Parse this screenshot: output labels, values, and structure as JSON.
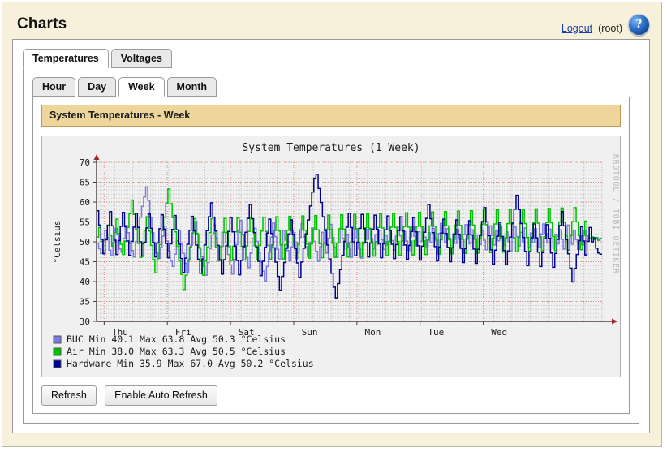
{
  "header": {
    "title": "Charts",
    "logout_label": "Logout",
    "user_label": "(root)",
    "help_glyph": "?"
  },
  "tabs_primary": [
    {
      "label": "Temperatures",
      "active": true
    },
    {
      "label": "Voltages",
      "active": false
    }
  ],
  "tabs_secondary": [
    {
      "label": "Hour",
      "active": false
    },
    {
      "label": "Day",
      "active": false
    },
    {
      "label": "Week",
      "active": true
    },
    {
      "label": "Month",
      "active": false
    }
  ],
  "section": {
    "banner_title": "System Temperatures - Week"
  },
  "buttons": {
    "refresh": "Refresh",
    "auto_refresh": "Enable Auto Refresh"
  },
  "chart_data": {
    "type": "line",
    "title": "System Temperatures (1 Week)",
    "watermark": "RRDTOOL / TOBI OETIKER",
    "xlabel": "",
    "ylabel": "°Celsius",
    "ylim": [
      30,
      70
    ],
    "ytick_step": 5,
    "yticks": [
      30,
      35,
      40,
      45,
      50,
      55,
      60,
      65,
      70
    ],
    "xticks": [
      "Thu",
      "Fri",
      "Sat",
      "Sun",
      "Mon",
      "Tue",
      "Wed"
    ],
    "grid": true,
    "grid_major_color": "#e08a80",
    "grid_minor_color": "#c9c9c9",
    "plot_bg": "#f0f0f0",
    "axis_color": "#4a3a3a",
    "axis_arrow_color": "#9c2a2a",
    "legend_position": "below",
    "series": [
      {
        "name": "BUC",
        "color": "#7b7be0",
        "min_label": "Min",
        "min": "40.1",
        "max_label": "Max",
        "max": "63.8",
        "avg_label": "Avg",
        "avg": "50.3",
        "unit": "°Celsius",
        "values": [
          49.6,
          48.3,
          47.1,
          50.4,
          52.8,
          51.2,
          47.9,
          46.5,
          49.8,
          53.4,
          51.7,
          48.2,
          47.4,
          50.9,
          54.1,
          52.3,
          49.6,
          47.8,
          46.2,
          50.1,
          53.8,
          56.2,
          58.9,
          61.3,
          63.8,
          60.4,
          56.1,
          52.3,
          49.7,
          47.2,
          45.8,
          48.6,
          51.4,
          53.9,
          50.2,
          47.6,
          45.1,
          43.8,
          46.9,
          50.3,
          52.8,
          49.4,
          47.1,
          44.6,
          42.3,
          45.7,
          49.2,
          52.6,
          55.1,
          51.8,
          48.4,
          46.2,
          43.9,
          41.6,
          44.8,
          48.3,
          51.7,
          54.2,
          50.9,
          47.5,
          45.3,
          48.9,
          52.4,
          49.7,
          46.8,
          44.2,
          41.9,
          45.6,
          49.3,
          52.8,
          55.4,
          51.9,
          48.6,
          46.1,
          43.5,
          47.2,
          50.8,
          53.4,
          50.1,
          47.3,
          44.9,
          42.6,
          40.1,
          43.8,
          47.4,
          51.2,
          54.7,
          51.3,
          48.1,
          45.7,
          49.3,
          52.9,
          50.4,
          47.8,
          45.2,
          48.7,
          52.3,
          49.9,
          47.4,
          51.1,
          54.6,
          51.2,
          48.8,
          46.3,
          49.9,
          53.5,
          50.1,
          47.6,
          45.1,
          48.8,
          52.4,
          49.8,
          47.2,
          50.9,
          54.4,
          51.1,
          48.6,
          46.2,
          49.8,
          53.3,
          50.9,
          48.4,
          51.9,
          48.5,
          46.1,
          49.7,
          53.2,
          50.8,
          48.3,
          45.9,
          49.5,
          53.1,
          50.6,
          53.2,
          50.7,
          48.3,
          51.8,
          49.4,
          52.9,
          50.5,
          48.1,
          51.6,
          49.2,
          52.7,
          50.3,
          47.9,
          51.4,
          53.9,
          51.5,
          49.1,
          52.6,
          50.2,
          47.8,
          51.3,
          53.8,
          51.4,
          49.0,
          52.5,
          50.1,
          53.6,
          51.2,
          48.8,
          52.3,
          49.9,
          53.4,
          51.0,
          48.6,
          52.1,
          54.6,
          52.2,
          49.8,
          53.3,
          50.9,
          48.5,
          52.0,
          49.6,
          53.1,
          50.7,
          48.3,
          51.8,
          54.3,
          51.9,
          49.5,
          53.0,
          50.6,
          48.2,
          51.7,
          49.3,
          52.8,
          50.4,
          48.0,
          51.5,
          54.0,
          51.6,
          49.2,
          52.7,
          50.3,
          53.8,
          51.4,
          49.0,
          52.5,
          50.1,
          47.7,
          51.2,
          53.7,
          51.3,
          48.9,
          52.4,
          50.0,
          53.5,
          51.1,
          48.7,
          52.2,
          49.8,
          53.3,
          50.9,
          48.5,
          52.0,
          54.5,
          52.1,
          49.7,
          53.2,
          50.8,
          48.4,
          51.9,
          49.5,
          53.0,
          50.6,
          48.2,
          51.7,
          54.2,
          51.8,
          49.4,
          52.9,
          50.5,
          48.1,
          51.6,
          49.2,
          52.7,
          50.3,
          51.0,
          50.8,
          51.2,
          50.6,
          51.1,
          50.4,
          50.9
        ]
      },
      {
        "name": "Air",
        "color": "#00c000",
        "min_label": "Min",
        "min": "38.0",
        "max_label": "Max",
        "max": "63.3",
        "avg_label": "Avg",
        "avg": "50.5",
        "unit": "°Celsius",
        "values": [
          51.2,
          53.6,
          50.1,
          47.4,
          50.8,
          54.2,
          51.6,
          48.9,
          52.3,
          55.7,
          52.1,
          49.4,
          46.8,
          50.2,
          53.6,
          57.1,
          60.5,
          56.9,
          53.2,
          49.6,
          46.1,
          49.5,
          52.9,
          56.3,
          52.7,
          49.1,
          45.6,
          42.2,
          45.8,
          49.3,
          52.8,
          56.2,
          59.7,
          63.3,
          59.6,
          56.1,
          52.5,
          48.9,
          45.3,
          41.8,
          38.0,
          41.6,
          45.2,
          48.7,
          52.2,
          55.8,
          52.1,
          48.6,
          45.1,
          41.6,
          45.2,
          48.7,
          52.3,
          55.8,
          52.2,
          48.7,
          45.2,
          48.8,
          52.4,
          55.9,
          52.3,
          48.8,
          45.3,
          48.9,
          52.5,
          56.0,
          52.4,
          48.9,
          45.4,
          49.0,
          52.6,
          56.1,
          52.5,
          49.0,
          45.5,
          49.1,
          52.7,
          56.2,
          52.6,
          49.1,
          45.6,
          49.2,
          52.8,
          56.3,
          52.7,
          49.2,
          45.7,
          49.3,
          52.9,
          56.4,
          52.8,
          49.3,
          45.8,
          49.4,
          53.0,
          56.5,
          52.9,
          49.4,
          45.9,
          49.5,
          53.1,
          56.6,
          53.0,
          49.5,
          46.0,
          49.6,
          53.2,
          56.7,
          53.1,
          49.6,
          46.1,
          49.7,
          53.3,
          56.8,
          53.2,
          49.7,
          46.2,
          49.8,
          53.4,
          56.9,
          53.3,
          49.8,
          46.3,
          49.9,
          53.5,
          57.0,
          53.4,
          49.9,
          46.4,
          50.0,
          53.6,
          57.1,
          53.5,
          50.0,
          46.5,
          50.1,
          53.7,
          57.2,
          53.6,
          50.1,
          46.6,
          50.2,
          53.8,
          57.3,
          53.7,
          50.2,
          46.7,
          50.3,
          53.9,
          57.4,
          53.8,
          50.3,
          46.8,
          50.4,
          54.0,
          57.5,
          53.9,
          50.4,
          46.9,
          50.5,
          54.1,
          57.6,
          54.0,
          50.5,
          47.0,
          50.6,
          54.2,
          57.7,
          54.1,
          50.6,
          47.1,
          50.7,
          54.3,
          57.8,
          54.2,
          50.7,
          47.2,
          50.8,
          54.4,
          57.9,
          54.3,
          50.8,
          47.3,
          50.9,
          54.5,
          58.0,
          54.4,
          50.9,
          47.4,
          51.0,
          54.6,
          58.1,
          54.5,
          51.0,
          47.5,
          51.1,
          54.7,
          58.2,
          54.6,
          51.1,
          47.6,
          51.2,
          54.8,
          58.3,
          54.7,
          51.2,
          47.7,
          51.3,
          54.9,
          58.4,
          54.8,
          51.3,
          47.8,
          51.4,
          55.0,
          58.5,
          54.9,
          51.4,
          47.9,
          51.5,
          55.1,
          58.6,
          55.0,
          51.5,
          48.0,
          51.6,
          55.2,
          51.4,
          50.8,
          51.2,
          50.6,
          51.0,
          50.4,
          50.8
        ]
      },
      {
        "name": "Hardware",
        "color": "#000090",
        "min_label": "Min",
        "min": "35.9",
        "max_label": "Max",
        "max": "67.0",
        "avg_label": "Avg",
        "avg": "50.2",
        "unit": "°Celsius",
        "values": [
          57.8,
          54.2,
          50.6,
          47.0,
          50.5,
          54.1,
          57.6,
          54.0,
          50.4,
          46.8,
          50.3,
          53.9,
          57.4,
          53.8,
          50.2,
          46.6,
          50.1,
          53.7,
          57.2,
          53.6,
          50.0,
          46.4,
          49.9,
          53.5,
          57.0,
          53.4,
          49.8,
          46.2,
          49.7,
          53.3,
          56.8,
          53.2,
          49.6,
          46.0,
          49.5,
          53.1,
          56.6,
          53.0,
          49.4,
          45.8,
          42.3,
          45.9,
          49.4,
          52.9,
          56.4,
          52.8,
          49.2,
          45.6,
          42.1,
          45.7,
          49.2,
          52.8,
          56.3,
          59.8,
          56.2,
          52.7,
          49.1,
          45.5,
          41.9,
          45.5,
          49.0,
          52.6,
          56.1,
          52.5,
          48.9,
          45.3,
          41.7,
          45.3,
          48.8,
          52.4,
          55.9,
          59.4,
          55.8,
          52.3,
          48.7,
          45.1,
          41.5,
          45.1,
          48.6,
          52.2,
          55.7,
          52.1,
          48.5,
          44.9,
          41.3,
          37.8,
          41.3,
          44.8,
          48.4,
          52.0,
          55.5,
          51.9,
          48.3,
          44.7,
          41.1,
          44.9,
          48.4,
          52.0,
          55.5,
          59.0,
          62.5,
          66.0,
          67.0,
          63.4,
          59.9,
          56.3,
          52.8,
          49.2,
          45.7,
          42.1,
          38.6,
          35.9,
          39.5,
          43.0,
          46.6,
          50.1,
          53.7,
          57.2,
          53.6,
          50.0,
          46.5,
          49.9,
          53.4,
          56.9,
          53.3,
          49.8,
          46.2,
          49.7,
          53.2,
          56.7,
          53.1,
          49.6,
          46.0,
          49.5,
          53.0,
          56.5,
          52.9,
          49.4,
          45.8,
          49.3,
          52.8,
          56.3,
          52.7,
          49.2,
          45.6,
          49.1,
          52.6,
          56.1,
          52.5,
          49.0,
          45.4,
          48.9,
          52.4,
          55.9,
          59.4,
          55.8,
          52.3,
          48.8,
          45.2,
          48.7,
          52.2,
          55.7,
          52.1,
          48.6,
          45.0,
          48.5,
          52.0,
          55.5,
          51.9,
          48.4,
          44.8,
          48.3,
          51.8,
          55.3,
          51.7,
          48.2,
          44.6,
          48.1,
          51.6,
          55.1,
          58.6,
          55.0,
          51.5,
          48.0,
          44.4,
          47.9,
          51.4,
          54.9,
          51.3,
          47.8,
          44.2,
          47.7,
          51.2,
          54.7,
          58.2,
          61.7,
          58.1,
          54.6,
          51.1,
          47.6,
          44.0,
          47.5,
          51.0,
          54.5,
          51.0,
          47.4,
          43.8,
          47.3,
          50.8,
          54.3,
          50.9,
          47.2,
          43.6,
          47.1,
          50.6,
          54.1,
          57.6,
          54.0,
          50.5,
          47.0,
          43.4,
          39.9,
          43.3,
          46.8,
          50.3,
          53.8,
          50.2,
          46.7,
          50.1,
          53.6,
          50.0,
          51.0,
          48.4,
          47.2,
          46.9
        ]
      }
    ]
  }
}
